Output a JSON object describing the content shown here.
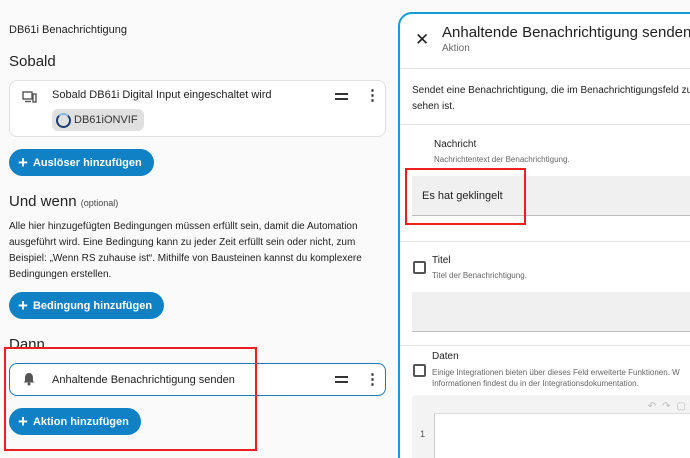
{
  "automation": {
    "title": "DB61i Benachrichtigung"
  },
  "trigger_section": {
    "heading": "Sobald",
    "item": {
      "label": "Sobald DB61i Digital Input eingeschaltet wird",
      "chip_label": "DB61iONVIF"
    },
    "add_button": "Auslöser hinzufügen"
  },
  "condition_section": {
    "heading": "Und wenn",
    "optional": "(optional)",
    "description": "Alle hier hinzugefügten Bedingungen müssen erfüllt sein, damit die Automation ausgeführt wird. Eine Bedingung kann zu jeder Zeit erfüllt sein oder nicht, zum Beispiel: „Wenn RS zuhause ist“. Mithilfe von Bausteinen kannst du komplexere Bedingungen erstellen.",
    "add_button": "Bedingung hinzufügen"
  },
  "action_section": {
    "heading": "Dann",
    "item": {
      "label": "Anhaltende Benachrichtigung senden"
    },
    "add_button": "Aktion hinzufügen"
  },
  "dialog": {
    "title": "Anhaltende Benachrichtigung senden",
    "subtitle": "Aktion",
    "description": "Sendet eine Benachrichtigung, die im Benachrichtigungsfeld zu sehen ist.",
    "message": {
      "label": "Nachricht",
      "hint": "Nachrichtentext der Benachrichtigung.",
      "value": "Es hat geklingelt"
    },
    "title_field": {
      "label": "Titel",
      "hint": "Titel der Benachrichtigung.",
      "value": ""
    },
    "data_field": {
      "label": "Daten",
      "hint_line1": "Einige Integrationen bieten über dieses Feld erweiterte Funktionen. W",
      "hint_line2": "Informationen findest du in der Integrationsdokumentation.",
      "line_number": "1"
    }
  },
  "colors": {
    "accent": "#0f81c4",
    "highlight": "#ec1f1f",
    "dialog_border": "#149dd4"
  }
}
